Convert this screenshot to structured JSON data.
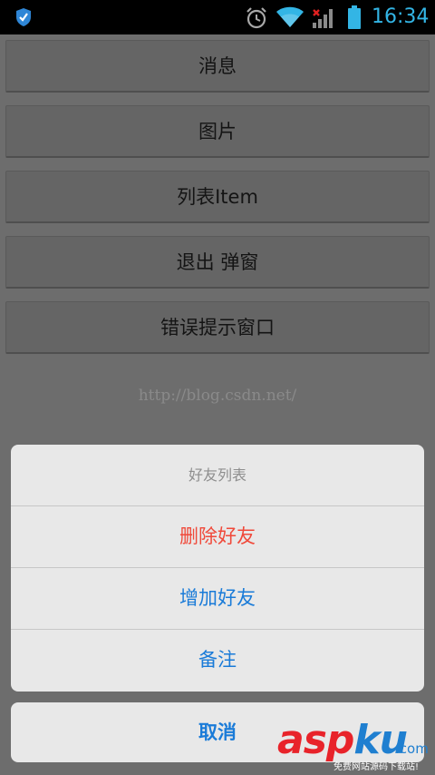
{
  "status_bar": {
    "time": "16:34",
    "icons": [
      "shield-icon",
      "alarm-icon",
      "wifi-icon",
      "signal-no-data-icon",
      "battery-icon"
    ],
    "accent_color": "#33b5e5"
  },
  "menu": {
    "buttons": [
      {
        "label": "消息"
      },
      {
        "label": "图片"
      },
      {
        "label": "列表Item"
      },
      {
        "label": "退出 弹窗"
      },
      {
        "label": "错误提示窗口"
      }
    ]
  },
  "watermark": "http://blog.csdn.net/",
  "action_sheet": {
    "title": "好友列表",
    "items": [
      {
        "label": "删除好友",
        "color": "#f0493a"
      },
      {
        "label": "增加好友",
        "color": "#1a7bd8"
      },
      {
        "label": "备注",
        "color": "#1a7bd8"
      }
    ],
    "cancel_label": "取消"
  },
  "logo": {
    "asp": "asp",
    "ku": "ku",
    "dotcom": ".com",
    "slogan": "免费网站源码下载站!"
  }
}
